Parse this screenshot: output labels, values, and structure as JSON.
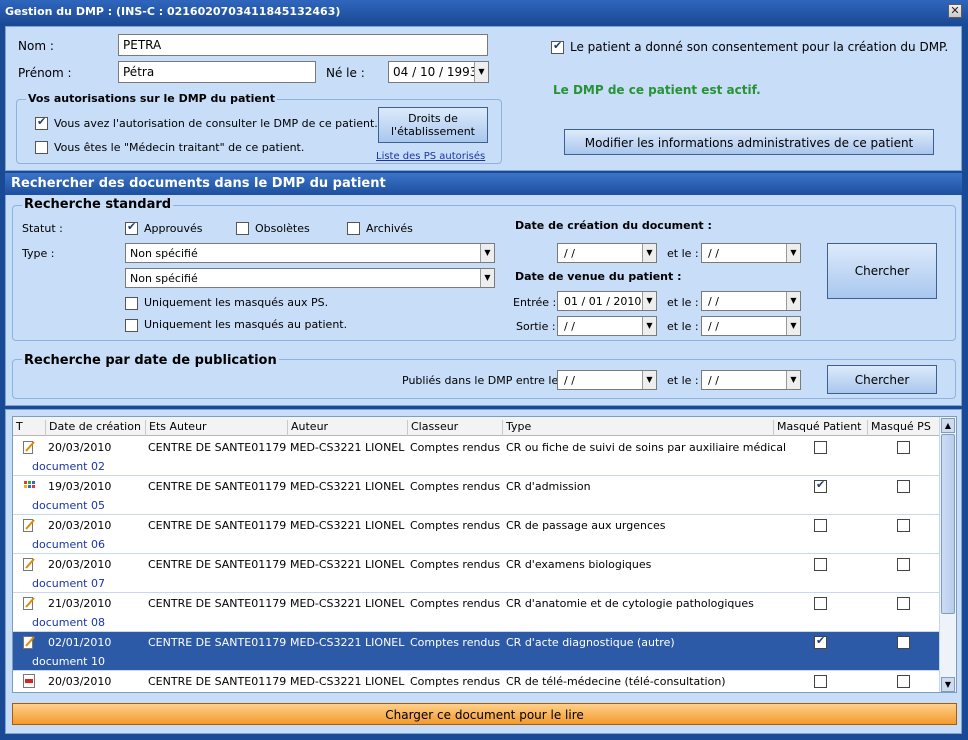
{
  "window": {
    "title": "Gestion du DMP :  (INS-C : 0216020703411845132463)",
    "close": "✕"
  },
  "patient": {
    "nom_label": "Nom :",
    "nom_value": "PETRA",
    "prenom_label": "Prénom :",
    "prenom_value": "Pétra",
    "ne_label": "Né le :",
    "ne_value": "04 / 10 / 1993",
    "consent_label": "Le patient a donné son consentement pour la création du DMP.",
    "consent_checked": true,
    "dmp_status": "Le DMP de ce patient est actif.",
    "modify_button": "Modifier les informations administratives de ce patient",
    "colors": {
      "status_green": "#279335"
    }
  },
  "autorisations": {
    "title": "Vos autorisations sur le DMP du patient",
    "consult_label": "Vous avez l'autorisation de consulter le DMP de ce patient.",
    "consult_checked": true,
    "traitant_label": "Vous êtes le \"Médecin traitant\" de ce patient.",
    "traitant_checked": false,
    "droits_button_l1": "Droits de",
    "droits_button_l2": "l'établissement",
    "ps_link": "Liste des PS autorisés"
  },
  "search": {
    "section_title": "Rechercher des documents dans le DMP du patient",
    "standard_title": "Recherche standard",
    "statut_label": "Statut :",
    "statut": [
      {
        "label": "Approuvés",
        "checked": true
      },
      {
        "label": "Obsolètes",
        "checked": false
      },
      {
        "label": "Archivés",
        "checked": false
      }
    ],
    "type_label": "Type :",
    "type1": "Non spécifié",
    "type2": "Non spécifié",
    "masques_ps": "Uniquement les masqués aux PS.",
    "masques_patient": "Uniquement les masqués au patient.",
    "creation_title": "Date de création du document :",
    "venue_title": "Date de venue du patient :",
    "entree_label": "Entrée :",
    "sortie_label": "Sortie :",
    "etle": "et le :",
    "empty_date": "  /   /",
    "entree_value": "01 / 01 / 2010",
    "chercher": "Chercher",
    "publication_title": "Recherche par date de publication",
    "publies_label": "Publiés dans le DMP entre le :",
    "chercher2": "Chercher"
  },
  "grid": {
    "headers": [
      "T",
      "Date de création",
      "Ets Auteur",
      "Auteur",
      "Classeur",
      "Type",
      "Masqué Patient",
      "Masqué PS"
    ],
    "rows": [
      {
        "icon": "edit-doc-icon",
        "date": "20/03/2010",
        "ets": "CENTRE DE SANTE01179",
        "auteur": "MED-CS3221 LIONEL",
        "classeur": "Comptes rendus",
        "type": "CR ou fiche de suivi de soins par auxiliaire médical",
        "doc": "document 02",
        "mp": false,
        "mps": false,
        "selected": false
      },
      {
        "icon": "grid-doc-icon",
        "date": "19/03/2010",
        "ets": "CENTRE DE SANTE01179",
        "auteur": "MED-CS3221 LIONEL",
        "classeur": "Comptes rendus",
        "type": "CR d'admission",
        "doc": "document 05",
        "mp": true,
        "mps": false,
        "selected": false
      },
      {
        "icon": "edit-doc-icon",
        "date": "20/03/2010",
        "ets": "CENTRE DE SANTE01179",
        "auteur": "MED-CS3221 LIONEL",
        "classeur": "Comptes rendus",
        "type": "CR de passage aux urgences",
        "doc": "document 06",
        "mp": false,
        "mps": false,
        "selected": false
      },
      {
        "icon": "edit-doc-icon",
        "date": "20/03/2010",
        "ets": "CENTRE DE SANTE01179",
        "auteur": "MED-CS3221 LIONEL",
        "classeur": "Comptes rendus",
        "type": "CR d'examens biologiques",
        "doc": "document 07",
        "mp": false,
        "mps": false,
        "selected": false
      },
      {
        "icon": "edit-doc-icon",
        "date": "21/03/2010",
        "ets": "CENTRE DE SANTE01179",
        "auteur": "MED-CS3221 LIONEL",
        "classeur": "Comptes rendus",
        "type": "CR d'anatomie et de cytologie pathologiques",
        "doc": "document 08",
        "mp": false,
        "mps": false,
        "selected": false
      },
      {
        "icon": "edit-doc-icon",
        "date": "02/01/2010",
        "ets": "CENTRE DE SANTE01179",
        "auteur": "MED-CS3221 LIONEL",
        "classeur": "Comptes rendus",
        "type": "CR d'acte diagnostique (autre)",
        "doc": "document 10",
        "mp": true,
        "mps": false,
        "selected": true
      },
      {
        "icon": "pdf-doc-icon",
        "date": "20/03/2010",
        "ets": "CENTRE DE SANTE01179",
        "auteur": "MED-CS3221 LIONEL",
        "classeur": "Comptes rendus",
        "type": "CR de télé-médecine (télé-consultation)",
        "doc": "",
        "mp": false,
        "mps": false,
        "selected": false
      }
    ]
  },
  "footer": {
    "load_button": "Charger ce document pour le lire"
  }
}
